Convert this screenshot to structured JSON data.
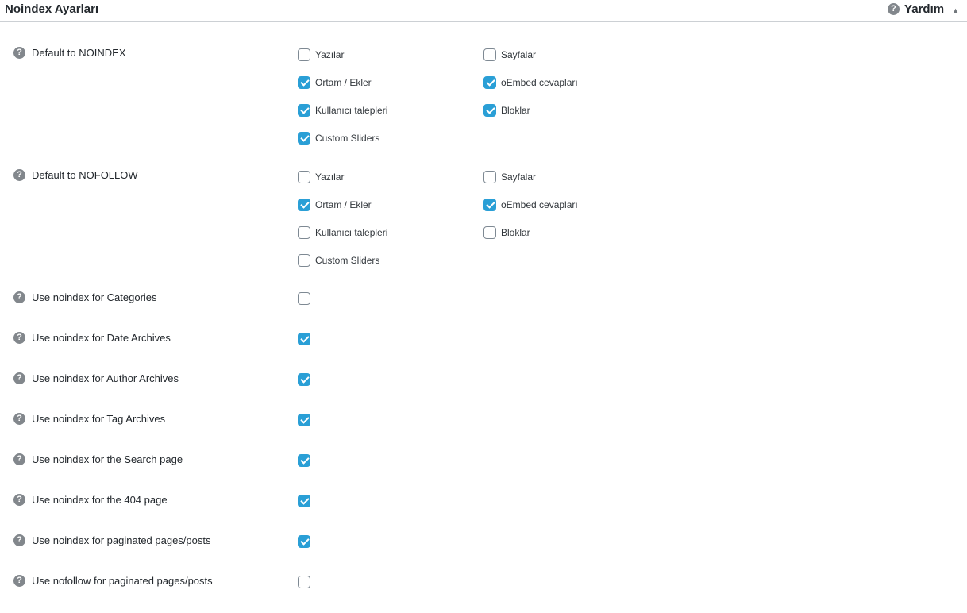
{
  "header": {
    "title": "Noindex Ayarları",
    "help_label": "Yardım",
    "help_icon": "question-circle-icon",
    "toggle_icon": "triangle-up-icon"
  },
  "accent_color": "#2a9fd6",
  "noindex_group": {
    "label": "Default to NOINDEX",
    "options": [
      {
        "label": "Yazılar",
        "checked": false
      },
      {
        "label": "Sayfalar",
        "checked": false
      },
      {
        "label": "Ortam / Ekler",
        "checked": true
      },
      {
        "label": "oEmbed cevapları",
        "checked": true
      },
      {
        "label": "Kullanıcı talepleri",
        "checked": true
      },
      {
        "label": "Bloklar",
        "checked": true
      },
      {
        "label": "Custom Sliders",
        "checked": true
      }
    ]
  },
  "nofollow_group": {
    "label": "Default to NOFOLLOW",
    "options": [
      {
        "label": "Yazılar",
        "checked": false
      },
      {
        "label": "Sayfalar",
        "checked": false
      },
      {
        "label": "Ortam / Ekler",
        "checked": true
      },
      {
        "label": "oEmbed cevapları",
        "checked": true
      },
      {
        "label": "Kullanıcı talepleri",
        "checked": false
      },
      {
        "label": "Bloklar",
        "checked": false
      },
      {
        "label": "Custom Sliders",
        "checked": false
      }
    ]
  },
  "settings": [
    {
      "label": "Use noindex for Categories",
      "checked": false
    },
    {
      "label": "Use noindex for Date Archives",
      "checked": true
    },
    {
      "label": "Use noindex for Author Archives",
      "checked": true
    },
    {
      "label": "Use noindex for Tag Archives",
      "checked": true
    },
    {
      "label": "Use noindex for the Search page",
      "checked": true
    },
    {
      "label": "Use noindex for the 404 page",
      "checked": true
    },
    {
      "label": "Use noindex for paginated pages/posts",
      "checked": true
    },
    {
      "label": "Use nofollow for paginated pages/posts",
      "checked": false
    }
  ]
}
